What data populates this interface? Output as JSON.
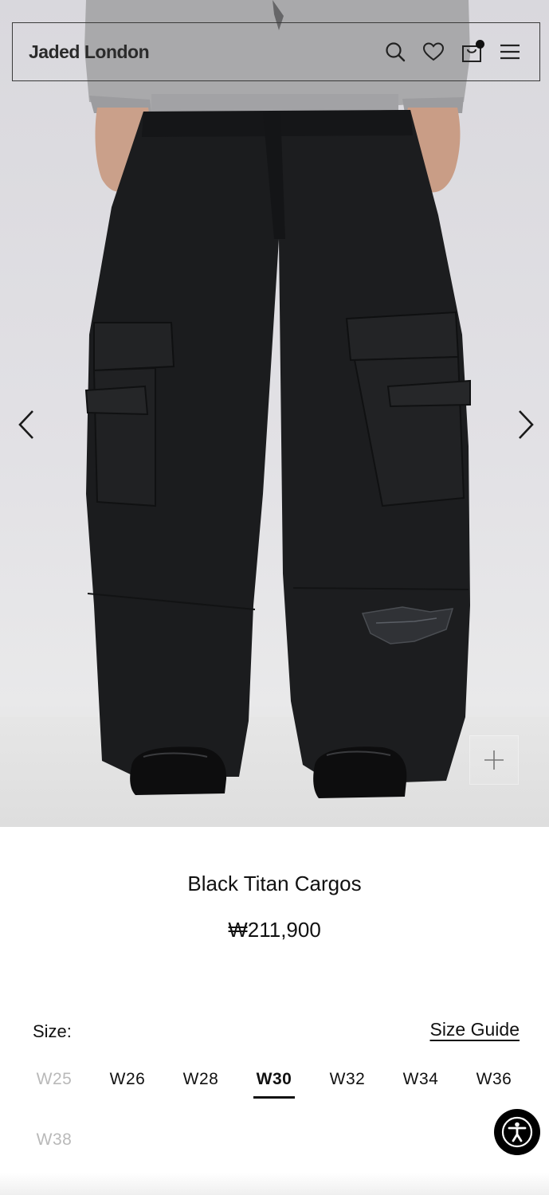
{
  "header": {
    "logo_text": "Jaded London",
    "icons": [
      "search-icon",
      "wishlist-icon",
      "cart-icon",
      "menu-icon"
    ],
    "cart_has_items": true
  },
  "gallery": {
    "prev_icon": "chevron-left-icon",
    "next_icon": "chevron-right-icon",
    "zoom_icon": "plus-icon"
  },
  "product": {
    "title": "Black Titan Cargos",
    "price": "₩211,900"
  },
  "size": {
    "label": "Size:",
    "guide_link": "Size Guide",
    "options": [
      {
        "label": "W25",
        "state": "unavailable"
      },
      {
        "label": "W26",
        "state": "available"
      },
      {
        "label": "W28",
        "state": "available"
      },
      {
        "label": "W30",
        "state": "selected"
      },
      {
        "label": "W32",
        "state": "available"
      },
      {
        "label": "W34",
        "state": "available"
      },
      {
        "label": "W36",
        "state": "available"
      },
      {
        "label": "W38",
        "state": "unavailable"
      }
    ]
  },
  "accessibility": {
    "icon": "accessibility-icon"
  },
  "colors": {
    "text": "#111111",
    "unavailable": "#b9b9b9",
    "photo_background": "#e2e1e5",
    "trousers": "#1a1b1d"
  }
}
